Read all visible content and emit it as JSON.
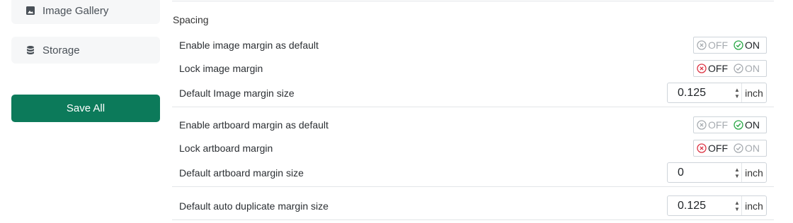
{
  "sidebar": {
    "items": [
      {
        "label": "Image Gallery",
        "icon": "image-icon"
      },
      {
        "label": "Storage",
        "icon": "database-icon"
      }
    ],
    "save_label": "Save All"
  },
  "spacing": {
    "title": "Spacing",
    "toggle_off": "OFF",
    "toggle_on": "ON",
    "rows": [
      {
        "label": "Enable image margin as default",
        "state": "ON"
      },
      {
        "label": "Lock image margin",
        "state": "OFF"
      },
      {
        "label": "Default Image margin size",
        "value": "0.125",
        "unit": "inch"
      },
      {
        "label": "Enable artboard margin as default",
        "state": "ON"
      },
      {
        "label": "Lock artboard margin",
        "state": "OFF"
      },
      {
        "label": "Default artboard margin size",
        "value": "0",
        "unit": "inch"
      },
      {
        "label": "Default auto duplicate margin size",
        "value": "0.125",
        "unit": "inch"
      }
    ]
  },
  "colors": {
    "primary": "#0c7a5a",
    "on_green": "#28a745",
    "off_red": "#dc3545",
    "dim": "#a6abb0"
  }
}
